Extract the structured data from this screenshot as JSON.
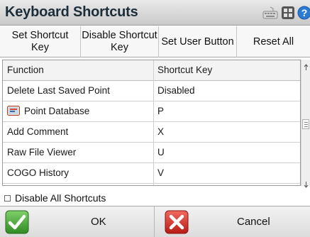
{
  "window": {
    "title": "Keyboard Shortcuts",
    "icons": [
      "keyboard-icon",
      "grid-icon",
      "help-icon"
    ]
  },
  "toolbar": {
    "set_shortcut_key": "Set Shortcut\nKey",
    "disable_shortcut_key": "Disable Shortcut\nKey",
    "set_user_button": "Set User Button",
    "reset_all": "Reset All"
  },
  "table": {
    "headers": {
      "function": "Function",
      "shortcut_key": "Shortcut Key"
    },
    "rows": [
      {
        "function": "Delete Last Saved Point",
        "shortcut_key": "Disabled"
      },
      {
        "function": "Point Database",
        "shortcut_key": "P",
        "icon": "point-database-icon"
      },
      {
        "function": "Add Comment",
        "shortcut_key": "X"
      },
      {
        "function": "Raw File Viewer",
        "shortcut_key": "U"
      },
      {
        "function": "COGO History",
        "shortcut_key": "V"
      }
    ]
  },
  "options": {
    "disable_all_shortcuts": {
      "label": "Disable All Shortcuts",
      "checked": false
    }
  },
  "footer": {
    "ok_label": "OK",
    "cancel_label": "Cancel"
  },
  "colors": {
    "ok_green": "#3a9a2a",
    "cancel_red": "#d42a22",
    "title_text": "#1c2d3a"
  }
}
